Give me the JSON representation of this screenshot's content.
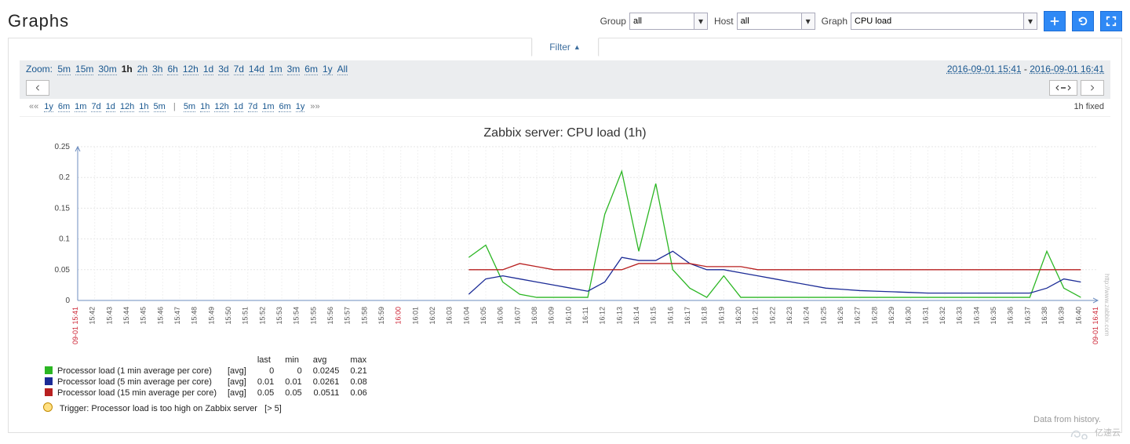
{
  "header": {
    "title": "Graphs",
    "group_label": "Group",
    "group_value": "all",
    "host_label": "Host",
    "host_value": "all",
    "graph_label": "Graph",
    "graph_value": "CPU load"
  },
  "filter": {
    "tab_label": "Filter",
    "zoom_label": "Zoom:",
    "zoom_options": [
      "5m",
      "15m",
      "30m",
      "1h",
      "2h",
      "3h",
      "6h",
      "12h",
      "1d",
      "3d",
      "7d",
      "14d",
      "1m",
      "3m",
      "6m",
      "1y",
      "All"
    ],
    "zoom_active": "1h",
    "range_from": "2016-09-01 15:41",
    "range_to": "2016-09-01 16:41",
    "shift_left_marker": "««",
    "shift_left": [
      "1y",
      "6m",
      "1m",
      "7d",
      "1d",
      "12h",
      "1h",
      "5m"
    ],
    "shift_divider": "|",
    "shift_right": [
      "5m",
      "1h",
      "12h",
      "1d",
      "7d",
      "1m",
      "6m",
      "1y"
    ],
    "shift_right_marker": "»»",
    "dur_label": "1h",
    "mode_label": "fixed"
  },
  "chart_data": {
    "type": "line",
    "title": "Zabbix server: CPU load (1h)",
    "xlabel": "",
    "ylabel": "",
    "ylim": [
      0,
      0.25
    ],
    "yticks": [
      0,
      0.05,
      0.1,
      0.15,
      0.2,
      0.25
    ],
    "x_start_label": "09-01 15:41",
    "x_end_label": "09-01 16:41",
    "x_ticks": [
      "15:42",
      "15:43",
      "15:44",
      "15:45",
      "15:46",
      "15:47",
      "15:48",
      "15:49",
      "15:50",
      "15:51",
      "15:52",
      "15:53",
      "15:54",
      "15:55",
      "15:56",
      "15:57",
      "15:58",
      "15:59",
      "16:00",
      "16:01",
      "16:02",
      "16:03",
      "16:04",
      "16:05",
      "16:06",
      "16:07",
      "16:08",
      "16:09",
      "16:10",
      "16:11",
      "16:12",
      "16:13",
      "16:14",
      "16:15",
      "16:16",
      "16:17",
      "16:18",
      "16:19",
      "16:20",
      "16:21",
      "16:22",
      "16:23",
      "16:24",
      "16:25",
      "16:26",
      "16:27",
      "16:28",
      "16:29",
      "16:30",
      "16:31",
      "16:32",
      "16:33",
      "16:34",
      "16:35",
      "16:36",
      "16:37",
      "16:38",
      "16:39",
      "16:40"
    ],
    "trigger_level": null,
    "series": [
      {
        "name": "Processor load (1 min average per core)",
        "color": "#2bb623",
        "agg": "avg",
        "values": [
          null,
          null,
          null,
          null,
          null,
          null,
          null,
          null,
          null,
          null,
          null,
          null,
          null,
          null,
          null,
          null,
          null,
          null,
          null,
          null,
          null,
          null,
          0.07,
          0.09,
          0.03,
          0.01,
          0.005,
          0.005,
          0.005,
          0.005,
          0.14,
          0.21,
          0.08,
          0.19,
          0.05,
          0.02,
          0.005,
          0.04,
          0.005,
          0.005,
          0.005,
          0.005,
          0.005,
          0.005,
          0.005,
          0.005,
          0.005,
          0.005,
          0.005,
          0.005,
          0.005,
          0.005,
          0.005,
          0.005,
          0.005,
          0.005,
          0.08,
          0.02,
          0.005
        ],
        "last": 0,
        "min": 0,
        "avg": 0.0245,
        "max": 0.21
      },
      {
        "name": "Processor load (5 min average per core)",
        "color": "#1b2b96",
        "agg": "avg",
        "values": [
          null,
          null,
          null,
          null,
          null,
          null,
          null,
          null,
          null,
          null,
          null,
          null,
          null,
          null,
          null,
          null,
          null,
          null,
          null,
          null,
          null,
          null,
          0.01,
          0.035,
          0.04,
          0.035,
          0.03,
          0.025,
          0.02,
          0.015,
          0.03,
          0.07,
          0.065,
          0.065,
          0.08,
          0.06,
          0.05,
          0.05,
          0.045,
          0.04,
          0.035,
          0.03,
          0.025,
          0.02,
          0.018,
          0.016,
          0.015,
          0.014,
          0.013,
          0.012,
          0.012,
          0.012,
          0.012,
          0.012,
          0.012,
          0.012,
          0.02,
          0.035,
          0.03
        ],
        "last": 0.01,
        "min": 0.01,
        "avg": 0.0261,
        "max": 0.08
      },
      {
        "name": "Processor load (15 min average per core)",
        "color": "#b82020",
        "agg": "avg",
        "values": [
          null,
          null,
          null,
          null,
          null,
          null,
          null,
          null,
          null,
          null,
          null,
          null,
          null,
          null,
          null,
          null,
          null,
          null,
          null,
          null,
          null,
          null,
          0.05,
          0.05,
          0.05,
          0.06,
          0.055,
          0.05,
          0.05,
          0.05,
          0.05,
          0.05,
          0.06,
          0.06,
          0.06,
          0.06,
          0.055,
          0.055,
          0.055,
          0.05,
          0.05,
          0.05,
          0.05,
          0.05,
          0.05,
          0.05,
          0.05,
          0.05,
          0.05,
          0.05,
          0.05,
          0.05,
          0.05,
          0.05,
          0.05,
          0.05,
          0.05,
          0.05,
          0.05
        ],
        "last": 0.05,
        "min": 0.05,
        "avg": 0.0511,
        "max": 0.06
      }
    ]
  },
  "legend": {
    "headers": [
      "last",
      "min",
      "avg",
      "max"
    ],
    "trigger_label": "Trigger: Processor load is too high on Zabbix server",
    "trigger_threshold": "[> 5]"
  },
  "footer": {
    "history_note": "Data from history.",
    "watermark_text": "亿速云"
  }
}
